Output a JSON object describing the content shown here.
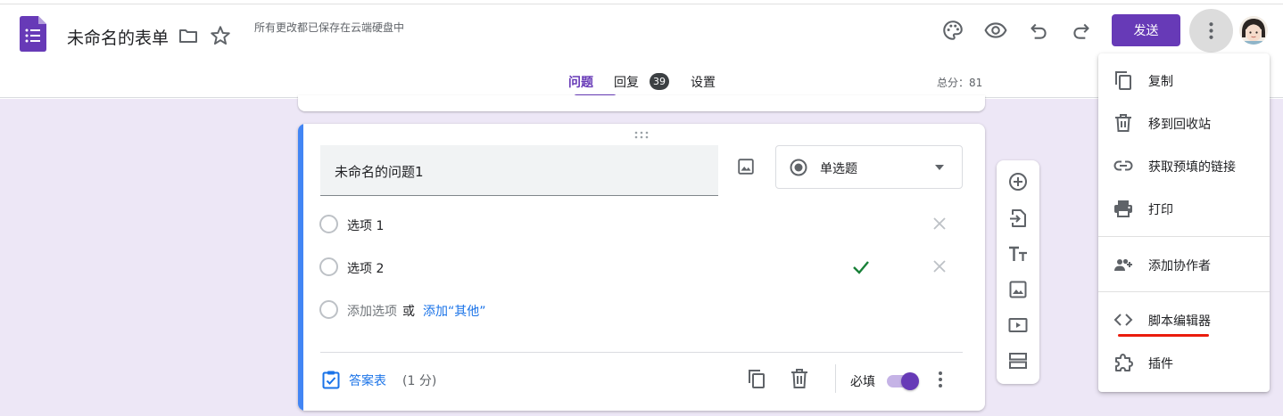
{
  "header": {
    "title": "未命名的表单",
    "save_status": "所有更改都已保存在云端硬盘中",
    "send_label": "发送"
  },
  "tabs": {
    "questions": "问题",
    "responses": "回复",
    "responses_count": "39",
    "settings": "设置"
  },
  "total_score": "总分：81",
  "question": {
    "title": "未命名的问题1",
    "type": "单选题",
    "options": [
      "选项 1",
      "选项 2"
    ],
    "add_option": "添加选项",
    "or": "或",
    "add_other": "添加“其他”",
    "answer_key": "答案表",
    "points": "(1 分)",
    "required_label": "必填",
    "required": true
  },
  "menu": {
    "items": [
      {
        "label": "复制",
        "icon": "copy-icon"
      },
      {
        "label": "移到回收站",
        "icon": "trash-icon"
      },
      {
        "label": "获取预填的链接",
        "icon": "link-icon"
      },
      {
        "label": "打印",
        "icon": "printer-icon"
      },
      {
        "label": "添加协作者",
        "icon": "add-person-icon"
      },
      {
        "label": "脚本编辑器",
        "icon": "code-icon"
      },
      {
        "label": "插件",
        "icon": "puzzle-icon"
      }
    ]
  },
  "colors": {
    "accent": "#673ab7",
    "card_accent": "#4285f4",
    "background": "#ede7f6",
    "link": "#1a73e8",
    "correct": "#188038",
    "highlight_underline": "#ea1c0d"
  }
}
